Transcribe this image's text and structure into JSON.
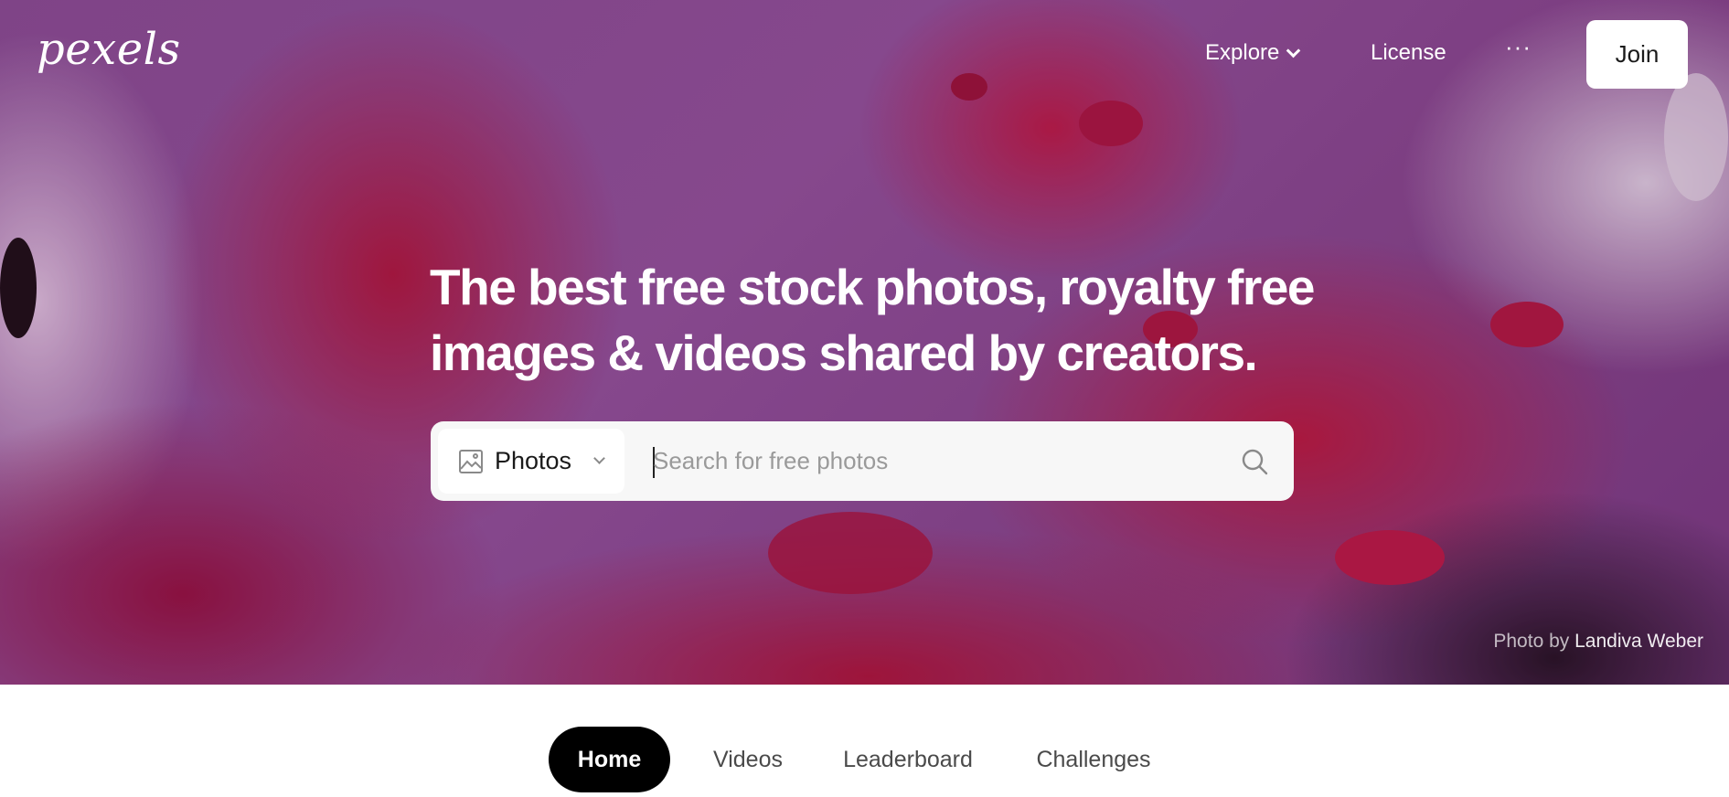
{
  "brand": {
    "logo_text": "pexels"
  },
  "nav": {
    "explore_label": "Explore",
    "license_label": "License",
    "more_label": "···",
    "join_label": "Join"
  },
  "hero": {
    "headline_line1": "The best free stock photos, royalty free",
    "headline_line2": "images & videos shared by creators.",
    "credit_prefix": "Photo by",
    "credit_author": "Landiva Weber"
  },
  "search": {
    "type_label": "Photos",
    "placeholder": "Search for free photos",
    "value": ""
  },
  "tabs": [
    {
      "label": "Home",
      "active": true
    },
    {
      "label": "Videos",
      "active": false
    },
    {
      "label": "Leaderboard",
      "active": false
    },
    {
      "label": "Challenges",
      "active": false
    }
  ],
  "colors": {
    "hero_base": "#8e4f98",
    "hero_accent": "#c0193f",
    "join_bg": "#ffffff",
    "active_tab_bg": "#000000"
  }
}
